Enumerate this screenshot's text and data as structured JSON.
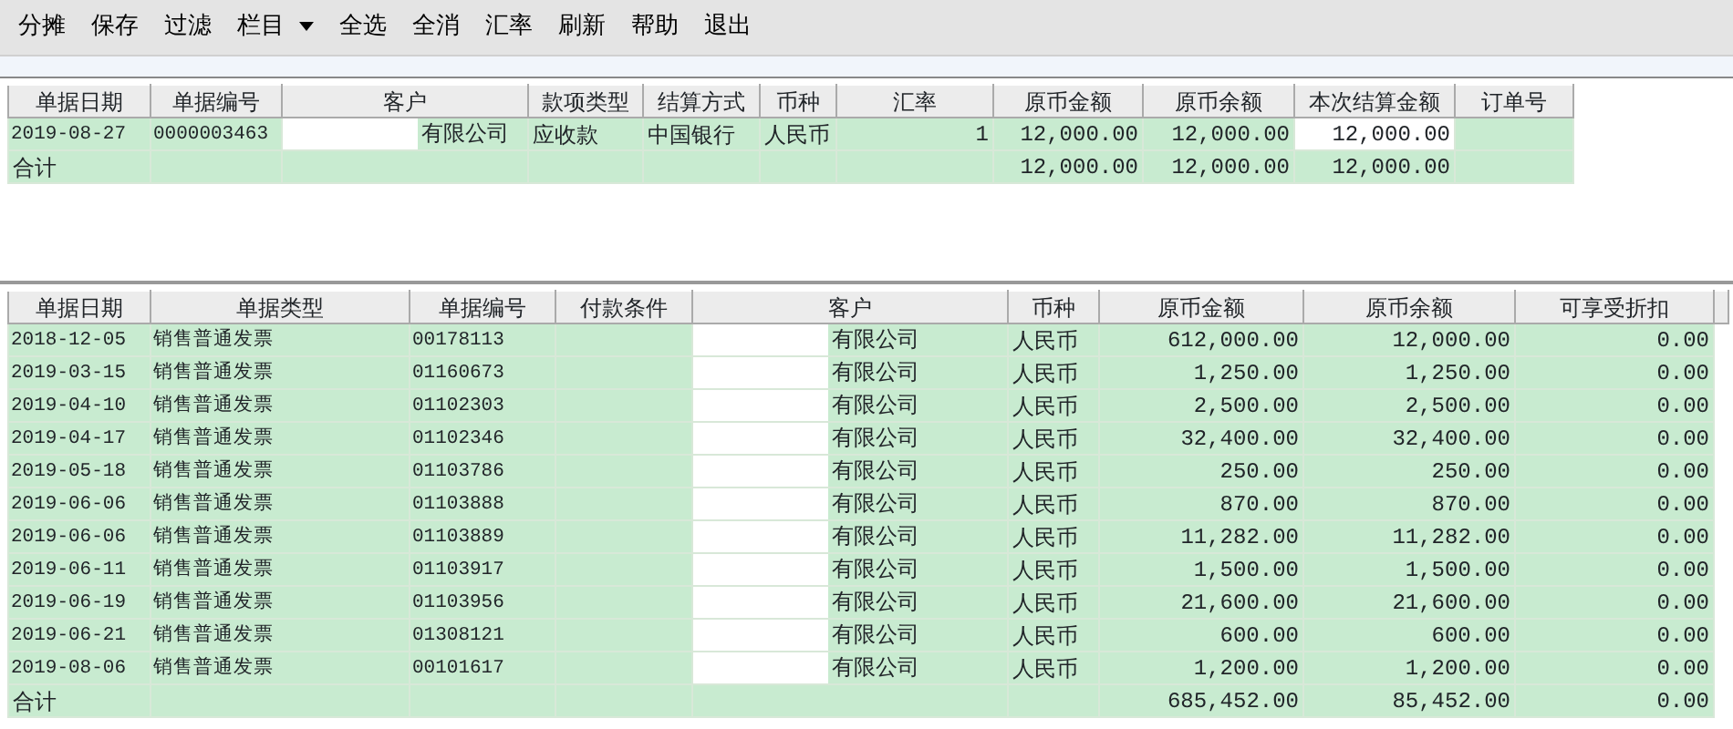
{
  "toolbar": [
    {
      "label": "分摊",
      "kind": "button"
    },
    {
      "label": "保存",
      "kind": "button"
    },
    {
      "label": "过滤",
      "kind": "button"
    },
    {
      "label": "栏目",
      "kind": "dropdown"
    },
    {
      "label": "全选",
      "kind": "button"
    },
    {
      "label": "全消",
      "kind": "button"
    },
    {
      "label": "汇率",
      "kind": "button"
    },
    {
      "label": "刷新",
      "kind": "button"
    },
    {
      "label": "帮助",
      "kind": "button"
    },
    {
      "label": "退出",
      "kind": "button"
    }
  ],
  "top_table": {
    "columns": [
      {
        "label": "单据日期",
        "kind": "text"
      },
      {
        "label": "单据编号",
        "kind": "text"
      },
      {
        "label": "客户",
        "kind": "customer"
      },
      {
        "label": "款项类型",
        "kind": "text"
      },
      {
        "label": "结算方式",
        "kind": "text"
      },
      {
        "label": "币种",
        "kind": "text"
      },
      {
        "label": "汇率",
        "kind": "number"
      },
      {
        "label": "原币金额",
        "kind": "number"
      },
      {
        "label": "原币余额",
        "kind": "number"
      },
      {
        "label": "本次结算金额",
        "kind": "input"
      },
      {
        "label": "订单号",
        "kind": "text"
      }
    ],
    "rows": [
      {
        "date": "2019-08-27",
        "doc_no": "0000003463",
        "customer": "有限公司",
        "payment_type": "应收款",
        "settlement": "中国银行",
        "currency": "人民币",
        "rate": "1",
        "amount": "12,000.00",
        "balance": "12,000.00",
        "settle_amount": "12,000.00"
      }
    ],
    "total": {
      "date": "合计",
      "amount": "12,000.00",
      "balance": "12,000.00",
      "settle_amount": "12,000.00"
    }
  },
  "bottom_table": {
    "columns": [
      {
        "label": "单据日期",
        "kind": "text"
      },
      {
        "label": "单据类型",
        "kind": "text"
      },
      {
        "label": "单据编号",
        "kind": "text"
      },
      {
        "label": "付款条件",
        "kind": "text"
      },
      {
        "label": "客户",
        "kind": "customer"
      },
      {
        "label": "币种",
        "kind": "text"
      },
      {
        "label": "原币金额",
        "kind": "number"
      },
      {
        "label": "原币余额",
        "kind": "number"
      },
      {
        "label": "可享受折扣",
        "kind": "number"
      }
    ],
    "rows": [
      {
        "date": "2018-12-05",
        "doc_type": "销售普通发票",
        "doc_no": "00178113",
        "customer": "有限公司",
        "currency": "人民币",
        "amount": "612,000.00",
        "balance": "12,000.00",
        "discount": "0.00"
      },
      {
        "date": "2019-03-15",
        "doc_type": "销售普通发票",
        "doc_no": "01160673",
        "customer": "有限公司",
        "currency": "人民币",
        "amount": "1,250.00",
        "balance": "1,250.00",
        "discount": "0.00"
      },
      {
        "date": "2019-04-10",
        "doc_type": "销售普通发票",
        "doc_no": "01102303",
        "customer": "有限公司",
        "currency": "人民币",
        "amount": "2,500.00",
        "balance": "2,500.00",
        "discount": "0.00"
      },
      {
        "date": "2019-04-17",
        "doc_type": "销售普通发票",
        "doc_no": "01102346",
        "customer": "有限公司",
        "currency": "人民币",
        "amount": "32,400.00",
        "balance": "32,400.00",
        "discount": "0.00"
      },
      {
        "date": "2019-05-18",
        "doc_type": "销售普通发票",
        "doc_no": "01103786",
        "customer": "有限公司",
        "currency": "人民币",
        "amount": "250.00",
        "balance": "250.00",
        "discount": "0.00"
      },
      {
        "date": "2019-06-06",
        "doc_type": "销售普通发票",
        "doc_no": "01103888",
        "customer": "有限公司",
        "currency": "人民币",
        "amount": "870.00",
        "balance": "870.00",
        "discount": "0.00"
      },
      {
        "date": "2019-06-06",
        "doc_type": "销售普通发票",
        "doc_no": "01103889",
        "customer": "有限公司",
        "currency": "人民币",
        "amount": "11,282.00",
        "balance": "11,282.00",
        "discount": "0.00"
      },
      {
        "date": "2019-06-11",
        "doc_type": "销售普通发票",
        "doc_no": "01103917",
        "customer": "有限公司",
        "currency": "人民币",
        "amount": "1,500.00",
        "balance": "1,500.00",
        "discount": "0.00"
      },
      {
        "date": "2019-06-19",
        "doc_type": "销售普通发票",
        "doc_no": "01103956",
        "customer": "有限公司",
        "currency": "人民币",
        "amount": "21,600.00",
        "balance": "21,600.00",
        "discount": "0.00"
      },
      {
        "date": "2019-06-21",
        "doc_type": "销售普通发票",
        "doc_no": "01308121",
        "customer": "有限公司",
        "currency": "人民币",
        "amount": "600.00",
        "balance": "600.00",
        "discount": "0.00"
      },
      {
        "date": "2019-08-06",
        "doc_type": "销售普通发票",
        "doc_no": "00101617",
        "customer": "有限公司",
        "currency": "人民币",
        "amount": "1,200.00",
        "balance": "1,200.00",
        "discount": "0.00"
      }
    ],
    "total": {
      "date": "合计",
      "amount": "685,452.00",
      "balance": "85,452.00",
      "discount": "0.00"
    }
  }
}
